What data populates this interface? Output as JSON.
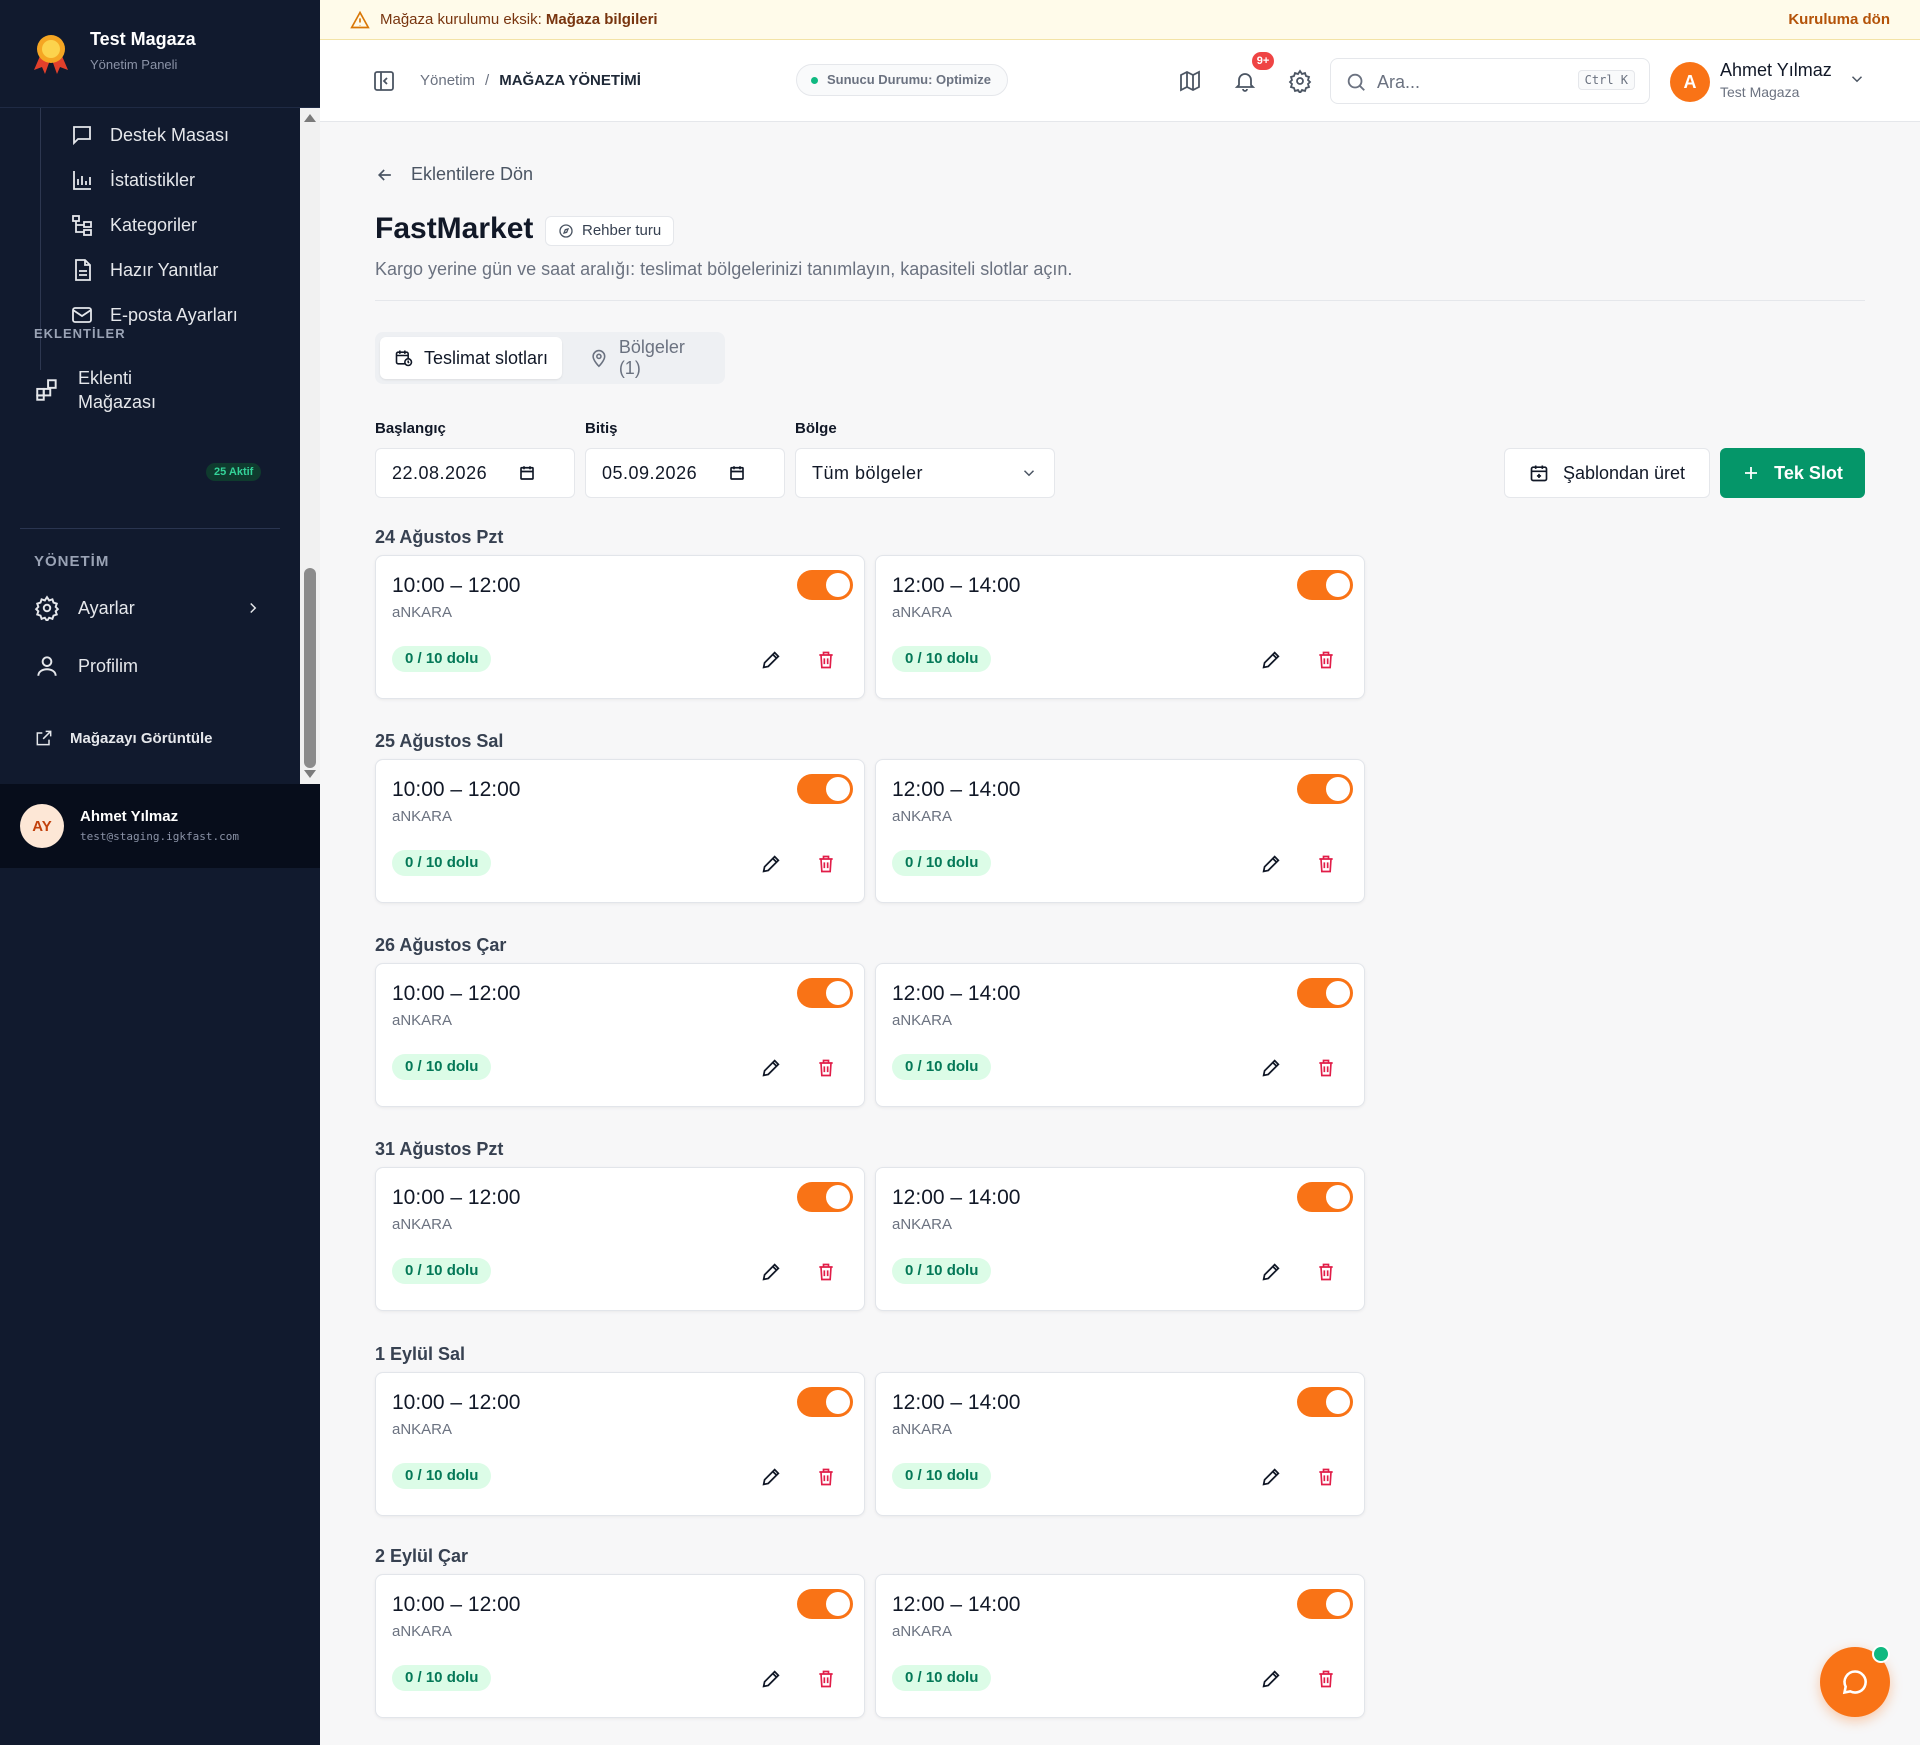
{
  "banner": {
    "prefix": "Mağaza kurulumu eksik:",
    "item": "Mağaza bilgileri",
    "link": "Kuruluma dön"
  },
  "sidebar": {
    "title": "Test Magaza",
    "subtitle": "Yönetim Paneli",
    "sub_items": [
      {
        "label": "Destek Masası",
        "icon": "chat-icon"
      },
      {
        "label": "İstatistikler",
        "icon": "bar-chart-icon"
      },
      {
        "label": "Kategoriler",
        "icon": "tree-icon"
      },
      {
        "label": "Hazır Yanıtlar",
        "icon": "document-icon"
      },
      {
        "label": "E-posta Ayarları",
        "icon": "mail-icon"
      }
    ],
    "section_plugins": "EKLENTİLER",
    "plugin_store_line1": "Eklenti",
    "plugin_store_line2": "Mağazası",
    "plugin_badge": "25 Aktif",
    "section_admin": "YÖNETİM",
    "settings": "Ayarlar",
    "profile": "Profilim",
    "view_store": "Mağazayı Görüntüle",
    "user_initials": "AY",
    "user_name": "Ahmet Yılmaz",
    "user_email": "test@staging.igkfast.com"
  },
  "header": {
    "breadcrumb_root": "Yönetim",
    "breadcrumb_sep": "/",
    "breadcrumb_current": "MAĞAZA YÖNETİMİ",
    "server_status": "Sunucu Durumu: Optimize",
    "notif_count": "9+",
    "search_placeholder": "Ara...",
    "search_shortcut": "Ctrl K",
    "user_initial": "A",
    "user_name": "Ahmet Yılmaz",
    "user_store": "Test Magaza"
  },
  "page": {
    "back": "Eklentilere Dön",
    "title": "FastMarket",
    "guide": "Rehber turu",
    "description": "Kargo yerine gün ve saat aralığı: teslimat bölgelerinizi tanımlayın, kapasiteli slotlar açın.",
    "tab_slots": "Teslimat slotları",
    "tab_regions": "Bölgeler (1)"
  },
  "filters": {
    "start_label": "Başlangıç",
    "start_value": "22.08.2026",
    "end_label": "Bitiş",
    "end_value": "05.09.2026",
    "region_label": "Bölge",
    "region_value": "Tüm bölgeler",
    "template_button": "Şablondan üret",
    "add_button": "Tek Slot"
  },
  "days": [
    {
      "label": "24 Ağustos Pzt",
      "slots": [
        {
          "time": "10:00 – 12:00",
          "region": "aNKARA",
          "capacity": "0 / 10 dolu",
          "enabled": true
        },
        {
          "time": "12:00 – 14:00",
          "region": "aNKARA",
          "capacity": "0 / 10 dolu",
          "enabled": true
        }
      ]
    },
    {
      "label": "25 Ağustos Sal",
      "slots": [
        {
          "time": "10:00 – 12:00",
          "region": "aNKARA",
          "capacity": "0 / 10 dolu",
          "enabled": true
        },
        {
          "time": "12:00 – 14:00",
          "region": "aNKARA",
          "capacity": "0 / 10 dolu",
          "enabled": true
        }
      ]
    },
    {
      "label": "26 Ağustos Çar",
      "slots": [
        {
          "time": "10:00 – 12:00",
          "region": "aNKARA",
          "capacity": "0 / 10 dolu",
          "enabled": true
        },
        {
          "time": "12:00 – 14:00",
          "region": "aNKARA",
          "capacity": "0 / 10 dolu",
          "enabled": true
        }
      ]
    },
    {
      "label": "31 Ağustos Pzt",
      "slots": [
        {
          "time": "10:00 – 12:00",
          "region": "aNKARA",
          "capacity": "0 / 10 dolu",
          "enabled": true
        },
        {
          "time": "12:00 – 14:00",
          "region": "aNKARA",
          "capacity": "0 / 10 dolu",
          "enabled": true
        }
      ]
    },
    {
      "label": "1 Eylül Sal",
      "slots": [
        {
          "time": "10:00 – 12:00",
          "region": "aNKARA",
          "capacity": "0 / 10 dolu",
          "enabled": true
        },
        {
          "time": "12:00 – 14:00",
          "region": "aNKARA",
          "capacity": "0 / 10 dolu",
          "enabled": true
        }
      ]
    },
    {
      "label": "2 Eylül Çar",
      "slots": [
        {
          "time": "10:00 – 12:00",
          "region": "aNKARA",
          "capacity": "0 / 10 dolu",
          "enabled": true
        },
        {
          "time": "12:00 – 14:00",
          "region": "aNKARA",
          "capacity": "0 / 10 dolu",
          "enabled": true
        }
      ]
    }
  ],
  "colors": {
    "sidebar_bg": "#111a2e",
    "accent_orange": "#f97316",
    "primary_green": "#059669",
    "danger": "#e11d48"
  }
}
